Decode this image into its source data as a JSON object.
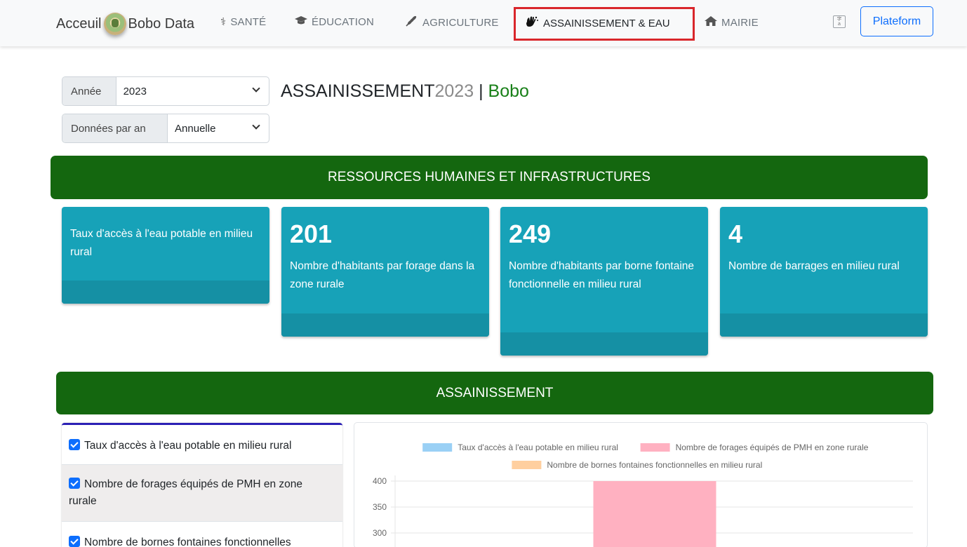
{
  "navbar": {
    "home_label": "Acceuil",
    "brand_label": "Bobo Data",
    "items": [
      {
        "label": "SANTÉ",
        "icon": "caduceus-icon"
      },
      {
        "label": "ÉDUCATION",
        "icon": "graduation-cap-icon"
      },
      {
        "label": "AGRICULTURE",
        "icon": "wheat-icon"
      },
      {
        "label": "ASSAINISSEMENT & EAU",
        "icon": "hands-wash-icon",
        "active": true
      },
      {
        "label": "MAIRIE",
        "icon": "home-icon"
      }
    ],
    "active_border_color": "#d9262b",
    "plateform_button": "Plateform",
    "lang_icon": "translate-icon"
  },
  "filters": {
    "year_label": "Année",
    "year_value": "2023",
    "period_label": "Données par an",
    "period_value": "Annuelle"
  },
  "title": {
    "main": "ASSAINISSEMENT",
    "year": "2023",
    "separator": " | ",
    "city": "Bobo"
  },
  "sections": {
    "rh_infra": "RESSOURCES HUMAINES ET INFRASTRUCTURES",
    "assainissement": "ASSAINISSEMENT"
  },
  "cards": [
    {
      "value": "",
      "label": "Taux d'accès à l'eau potable en milieu rural"
    },
    {
      "value": "201",
      "label": "Nombre d'habitants par forage dans la zone rurale"
    },
    {
      "value": "249",
      "label": "Nombre d'habitants par borne fontaine fonctionnelle en milieu rural"
    },
    {
      "value": "4",
      "label": "Nombre de barrages en milieu rural"
    }
  ],
  "checklist": [
    {
      "label": "Taux d'accès à l'eau potable en milieu rural",
      "checked": true
    },
    {
      "label": "Nombre de forages équipés de PMH en zone rurale",
      "checked": true
    },
    {
      "label": "Nombre de bornes fontaines fonctionnelles",
      "checked": true
    }
  ],
  "colors": {
    "section_green": "#14670f",
    "card_teal": "#17a2b8",
    "primary_blue": "#0d6efd"
  },
  "chart_data": {
    "type": "bar",
    "series": [
      {
        "name": "Taux d'accès à l'eau potable en milieu rural",
        "color": "#9ad0f5",
        "values": [
          0
        ]
      },
      {
        "name": "Nombre de forages équipés de PMH en zone rurale",
        "color": "#ffb1c1",
        "values": [
          400
        ]
      },
      {
        "name": "Nombre de bornes fontaines fonctionnelles en milieu rural",
        "color": "#ffcf9f",
        "values": [
          0
        ]
      }
    ],
    "y_ticks": [
      400,
      350,
      300
    ],
    "ylim": [
      0,
      400
    ],
    "legend_position": "top",
    "grid": true
  }
}
